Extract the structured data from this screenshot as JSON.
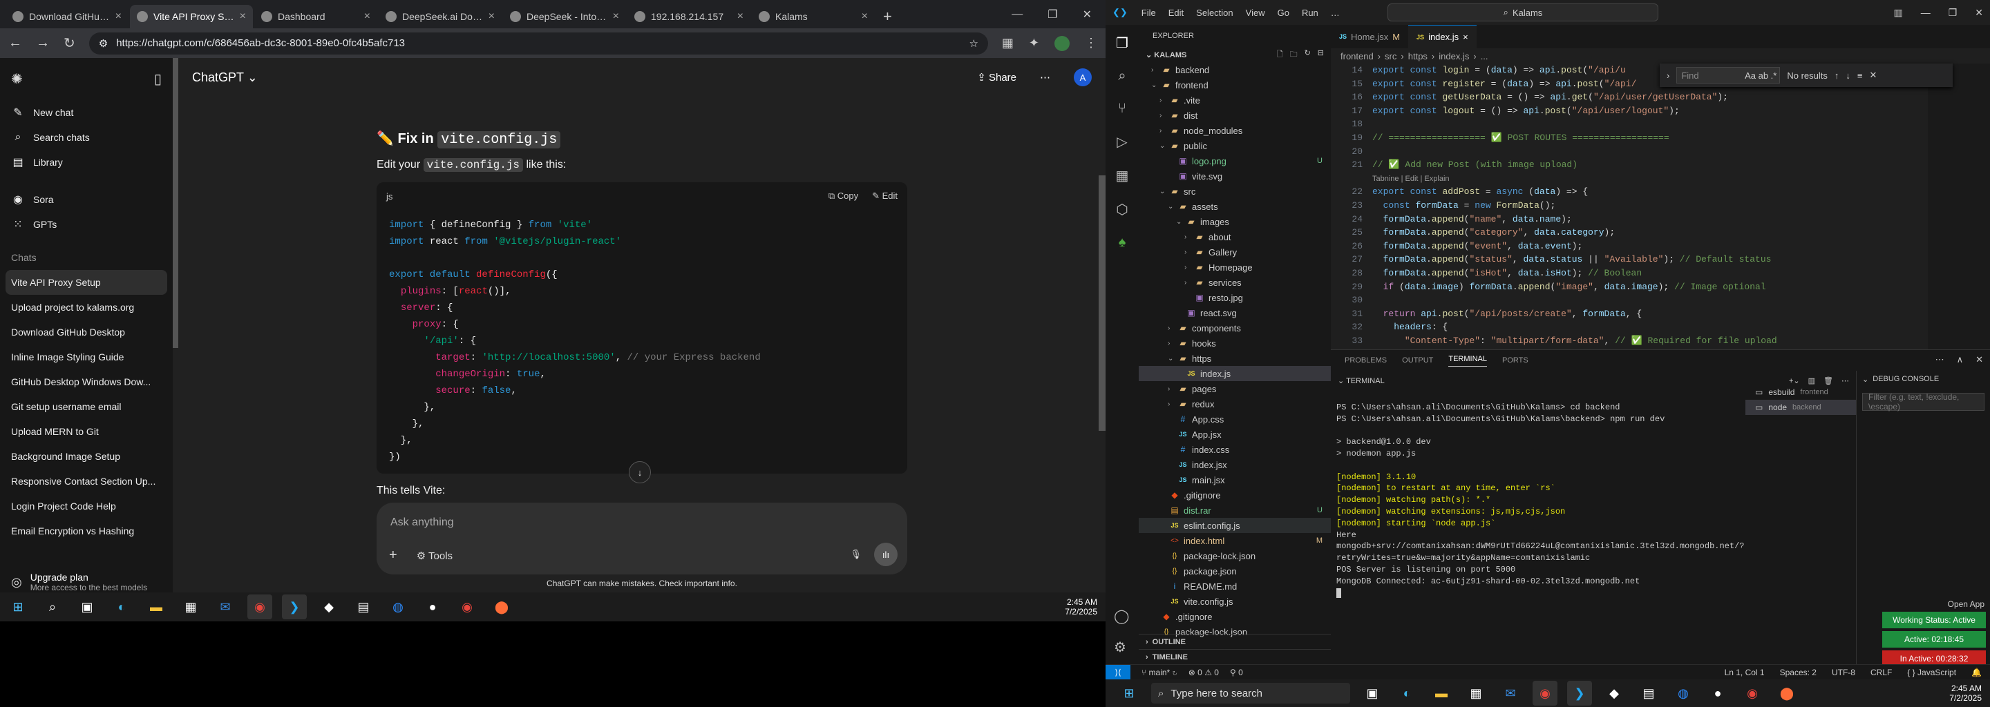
{
  "browser": {
    "tabs": [
      {
        "title": "Download GitHub Desktop",
        "icon": "github-icon",
        "active": false
      },
      {
        "title": "Vite API Proxy Setup",
        "icon": "chatgpt-icon",
        "active": true
      },
      {
        "title": "Dashboard",
        "icon": "dashboard-icon",
        "active": false
      },
      {
        "title": "DeepSeek.ai Domain F",
        "icon": "deepseek-icon",
        "active": false
      },
      {
        "title": "DeepSeek - Into the U",
        "icon": "deepseek-icon",
        "active": false
      },
      {
        "title": "192.168.214.157",
        "icon": "globe-icon",
        "active": false
      },
      {
        "title": "Kalams",
        "icon": "kalams-icon",
        "active": false
      }
    ],
    "url": "https://chatgpt.com/c/686456ab-dc3c-8001-89e0-0fc4b5afc713"
  },
  "chatgpt": {
    "title": "ChatGPT",
    "share": "Share",
    "avatar": "A",
    "nav": [
      {
        "label": "New chat",
        "icon": "compose-icon"
      },
      {
        "label": "Search chats",
        "icon": "search-icon"
      },
      {
        "label": "Library",
        "icon": "library-icon"
      },
      {
        "label": "Sora",
        "icon": "sora-icon"
      },
      {
        "label": "GPTs",
        "icon": "gpts-icon"
      }
    ],
    "chats_heading": "Chats",
    "chats": [
      "Vite API Proxy Setup",
      "Upload project to kalams.org",
      "Download GitHub Desktop",
      "Inline Image Styling Guide",
      "GitHub Desktop Windows Dow...",
      "Git setup username email",
      "Upload MERN to Git",
      "Background Image Setup",
      "Responsive Contact Section Up...",
      "Login Project Code Help",
      "Email Encryption vs Hashing"
    ],
    "upgrade": {
      "title": "Upgrade plan",
      "subtitle": "More access to the best models"
    },
    "fix_title": "Fix in",
    "fix_file": "vite.config.js",
    "edit_pre": "Edit your",
    "edit_file": "vite.config.js",
    "edit_post": "like this:",
    "code_lang": "js",
    "copy": "Copy",
    "edit": "Edit",
    "tells": "This tells Vite:",
    "placeholder": "Ask anything",
    "tools": "Tools",
    "disclaimer": "ChatGPT can make mistakes. Check important info."
  },
  "taskbar1": {
    "time": "2:45 AM",
    "date": "7/2/2025"
  },
  "vscode": {
    "menu": [
      "File",
      "Edit",
      "Selection",
      "View",
      "Go",
      "Run"
    ],
    "search": "Kalams",
    "explorer_label": "EXPLORER",
    "root": "KALAMS",
    "tree": [
      {
        "name": "backend",
        "type": "folder",
        "depth": 1,
        "open": false
      },
      {
        "name": "frontend",
        "type": "folder",
        "depth": 1,
        "open": true
      },
      {
        "name": ".vite",
        "type": "folder",
        "depth": 2,
        "open": false
      },
      {
        "name": "dist",
        "type": "folder",
        "depth": 2,
        "open": false
      },
      {
        "name": "node_modules",
        "type": "folder",
        "depth": 2,
        "open": false
      },
      {
        "name": "public",
        "type": "folder",
        "depth": 2,
        "open": true
      },
      {
        "name": "logo.png",
        "type": "file",
        "depth": 3,
        "badge": "U"
      },
      {
        "name": "vite.svg",
        "type": "file",
        "depth": 3
      },
      {
        "name": "src",
        "type": "folder",
        "depth": 2,
        "open": true
      },
      {
        "name": "assets",
        "type": "folder",
        "depth": 3,
        "open": true
      },
      {
        "name": "images",
        "type": "folder",
        "depth": 4,
        "open": true
      },
      {
        "name": "about",
        "type": "folder",
        "depth": 5,
        "open": false
      },
      {
        "name": "Gallery",
        "type": "folder",
        "depth": 5,
        "open": false
      },
      {
        "name": "Homepage",
        "type": "folder",
        "depth": 5,
        "open": false
      },
      {
        "name": "services",
        "type": "folder",
        "depth": 5,
        "open": false
      },
      {
        "name": "resto.jpg",
        "type": "file",
        "depth": 5
      },
      {
        "name": "react.svg",
        "type": "file",
        "depth": 4
      },
      {
        "name": "components",
        "type": "folder",
        "depth": 3,
        "open": false
      },
      {
        "name": "hooks",
        "type": "folder",
        "depth": 3,
        "open": false
      },
      {
        "name": "https",
        "type": "folder",
        "depth": 3,
        "open": true
      },
      {
        "name": "index.js",
        "type": "file",
        "depth": 4,
        "selected": true
      },
      {
        "name": "pages",
        "type": "folder",
        "depth": 3,
        "open": false
      },
      {
        "name": "redux",
        "type": "folder",
        "depth": 3,
        "open": false
      },
      {
        "name": "App.css",
        "type": "file",
        "depth": 3
      },
      {
        "name": "App.jsx",
        "type": "file",
        "depth": 3
      },
      {
        "name": "index.css",
        "type": "file",
        "depth": 3
      },
      {
        "name": "index.jsx",
        "type": "file",
        "depth": 3
      },
      {
        "name": "main.jsx",
        "type": "file",
        "depth": 3
      },
      {
        "name": ".gitignore",
        "type": "file",
        "depth": 2
      },
      {
        "name": "dist.rar",
        "type": "file",
        "depth": 2,
        "badge": "U"
      },
      {
        "name": "eslint.config.js",
        "type": "file",
        "depth": 2,
        "highlight": true
      },
      {
        "name": "index.html",
        "type": "file",
        "depth": 2,
        "badge": "M"
      },
      {
        "name": "package-lock.json",
        "type": "file",
        "depth": 2
      },
      {
        "name": "package.json",
        "type": "file",
        "depth": 2
      },
      {
        "name": "README.md",
        "type": "file",
        "depth": 2
      },
      {
        "name": "vite.config.js",
        "type": "file",
        "depth": 2
      },
      {
        "name": ".gitignore",
        "type": "file",
        "depth": 1
      },
      {
        "name": "package-lock.json",
        "type": "file",
        "depth": 1
      }
    ],
    "outline": "OUTLINE",
    "timeline": "TIMELINE",
    "tabs": [
      {
        "label": "Home.jsx",
        "badge": "M",
        "active": false
      },
      {
        "label": "index.js",
        "badge": "",
        "active": true
      }
    ],
    "breadcrumb": [
      "frontend",
      "src",
      "https",
      "index.js",
      "..."
    ],
    "find_placeholder": "Find",
    "find_result": "No results",
    "code_lines": [
      {
        "n": "14",
        "h": "<span class='kw'>export</span> <span class='kw'>const</span> <span class='fn'>login</span> = (<span class='vr'>data</span>) => <span class='vr'>api</span>.<span class='fn'>post</span>(<span class='str'>\"/api/u</span>"
      },
      {
        "n": "15",
        "h": "<span class='kw'>export</span> <span class='kw'>const</span> <span class='fn'>register</span> = (<span class='vr'>data</span>) => <span class='vr'>api</span>.<span class='fn'>post</span>(<span class='str'>\"/api/</span>"
      },
      {
        "n": "16",
        "h": "<span class='kw'>export</span> <span class='kw'>const</span> <span class='fn'>getUserData</span> = () => <span class='vr'>api</span>.<span class='fn'>get</span>(<span class='str'>\"/api/user/getUserData\"</span>);"
      },
      {
        "n": "17",
        "h": "<span class='kw'>export</span> <span class='kw'>const</span> <span class='fn'>logout</span> = () => <span class='vr'>api</span>.<span class='fn'>post</span>(<span class='str'>\"/api/user/logout\"</span>);"
      },
      {
        "n": "18",
        "h": ""
      },
      {
        "n": "19",
        "h": "<span class='cm'>// ================== ✅ POST ROUTES ==================</span>"
      },
      {
        "n": "20",
        "h": ""
      },
      {
        "n": "21",
        "h": "<span class='cm'>// ✅ Add new Post (with image upload)</span>"
      },
      {
        "n": "",
        "h": "<span style='color:#999;font-family:Liberation Sans,sans-serif;font-size:11px'>Tabnine | Edit | Explain</span>"
      },
      {
        "n": "22",
        "h": "<span class='kw'>export</span> <span class='kw'>const</span> <span class='fn'>addPost</span> = <span class='kw'>async</span> (<span class='vr'>data</span>) => {"
      },
      {
        "n": "23",
        "h": "  <span class='kw'>const</span> <span class='vr'>formData</span> = <span class='kw'>new</span> <span class='fn'>FormData</span>();"
      },
      {
        "n": "24",
        "h": "  <span class='vr'>formData</span>.<span class='fn'>append</span>(<span class='str'>\"name\"</span>, <span class='vr'>data</span>.<span class='vr'>name</span>);"
      },
      {
        "n": "25",
        "h": "  <span class='vr'>formData</span>.<span class='fn'>append</span>(<span class='str'>\"category\"</span>, <span class='vr'>data</span>.<span class='vr'>category</span>);"
      },
      {
        "n": "26",
        "h": "  <span class='vr'>formData</span>.<span class='fn'>append</span>(<span class='str'>\"event\"</span>, <span class='vr'>data</span>.<span class='vr'>event</span>);"
      },
      {
        "n": "27",
        "h": "  <span class='vr'>formData</span>.<span class='fn'>append</span>(<span class='str'>\"status\"</span>, <span class='vr'>data</span>.<span class='vr'>status</span> || <span class='str'>\"Available\"</span>); <span class='cm'>// Default status</span>"
      },
      {
        "n": "28",
        "h": "  <span class='vr'>formData</span>.<span class='fn'>append</span>(<span class='str'>\"isHot\"</span>, <span class='vr'>data</span>.<span class='vr'>isHot</span>); <span class='cm'>// Boolean</span>"
      },
      {
        "n": "29",
        "h": "  <span class='ck'>if</span> (<span class='vr'>data</span>.<span class='vr'>image</span>) <span class='vr'>formData</span>.<span class='fn'>append</span>(<span class='str'>\"image\"</span>, <span class='vr'>data</span>.<span class='vr'>image</span>); <span class='cm'>// Image optional</span>"
      },
      {
        "n": "30",
        "h": ""
      },
      {
        "n": "31",
        "h": "  <span class='ck'>return</span> <span class='vr'>api</span>.<span class='fn'>post</span>(<span class='str'>\"/api/posts/create\"</span>, <span class='vr'>formData</span>, {"
      },
      {
        "n": "32",
        "h": "    <span class='vr'>headers</span>: {"
      },
      {
        "n": "33",
        "h": "      <span class='str'>\"Content-Type\"</span>: <span class='str'>\"multipart/form-data\"</span>, <span class='cm'>// ✅ Required for file upload</span>"
      },
      {
        "n": "34",
        "h": "    },"
      }
    ],
    "panel_tabs": [
      "PROBLEMS",
      "OUTPUT",
      "TERMINAL",
      "PORTS"
    ],
    "terminal_label": "TERMINAL",
    "terminal_lines": [
      "",
      "PS C:\\Users\\ahsan.ali\\Documents\\GitHub\\Kalams> cd backend",
      "PS C:\\Users\\ahsan.ali\\Documents\\GitHub\\Kalams\\backend> npm run dev",
      "",
      "> backend@1.0.0 dev",
      "> nodemon app.js",
      "",
      "[nodemon] 3.1.10",
      "[nodemon] to restart at any time, enter `rs`",
      "[nodemon] watching path(s): *.*",
      "[nodemon] watching extensions: js,mjs,cjs,json",
      "[nodemon] starting `node app.js`",
      "Here",
      "mongodb+srv://comtanixahsan:dWM9rUtTd66224uL@comtanixislamic.3tel3zd.mongodb.net/?",
      "retryWrites=true&w=majority&appName=comtanixislamic",
      "POS Server is listening on port 5000",
      "MongoDB Connected: ac-6utjz91-shard-00-02.3tel3zd.mongodb.net"
    ],
    "term_list": [
      {
        "label": "esbuild",
        "sub": "frontend"
      },
      {
        "label": "node",
        "sub": "backend"
      }
    ],
    "debug_label": "DEBUG CONSOLE",
    "debug_filter": "Filter (e.g. text, !exclude, \\escape)",
    "open_app": "Open App",
    "chips": [
      {
        "label": "Working Status: Active",
        "color": "#1e8e3e"
      },
      {
        "label": "Active: 02:18:45",
        "color": "#1e8e3e"
      },
      {
        "label": "In Active: 00:28:32",
        "color": "#c5221f"
      }
    ],
    "status": {
      "branch": "main*",
      "errors": "0",
      "warnings": "0",
      "ports": "0",
      "position": "Ln 1, Col 1",
      "spaces": "Spaces: 2",
      "encoding": "UTF-8",
      "eol": "CRLF",
      "lang": "JavaScript"
    }
  },
  "taskbar2": {
    "search": "Type here to search",
    "time": "2:45 AM",
    "date": "7/2/2025"
  }
}
